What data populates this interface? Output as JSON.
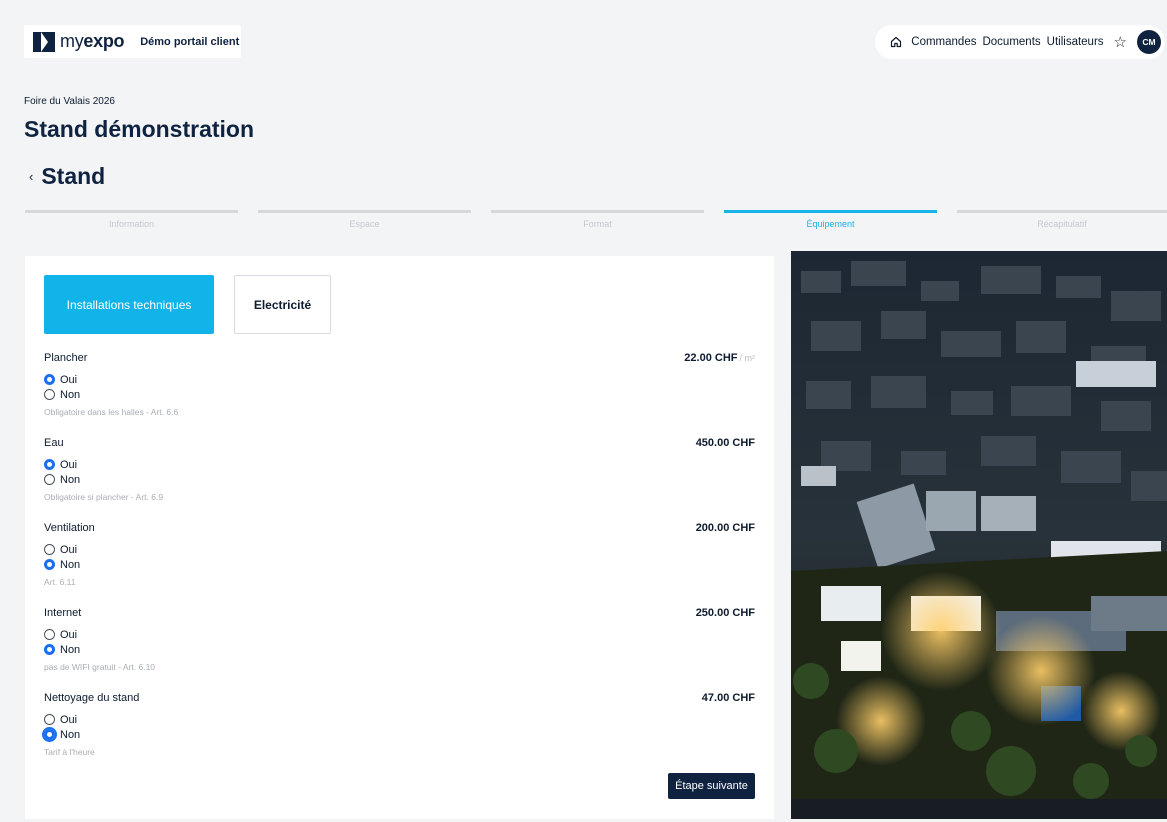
{
  "brand": {
    "logo_prefix": "my",
    "logo_bold": "expo",
    "portal_name": "Démo portail client"
  },
  "nav": {
    "items": [
      "Commandes",
      "Documents",
      "Utilisateurs"
    ],
    "avatar": "CM",
    "home_icon": "home-icon",
    "star_icon": "star-icon"
  },
  "page": {
    "event": "Foire du Valais 2026",
    "title": "Stand démonstration",
    "section": "Stand",
    "back_icon": "chevron-left-icon"
  },
  "steps": [
    {
      "label": "Information",
      "active": false
    },
    {
      "label": "Espace",
      "active": false
    },
    {
      "label": "Format",
      "active": false
    },
    {
      "label": "Équipement",
      "active": true
    },
    {
      "label": "Récapitulatif",
      "active": false
    }
  ],
  "tabs": {
    "active": "Installations techniques",
    "inactive": "Electricité"
  },
  "options": [
    {
      "name": "Plancher",
      "price": "22.00 CHF",
      "unit": "/ m²",
      "yes": "Oui",
      "no": "Non",
      "selected": "oui",
      "note": "Obligatoire dans les halles - Art. 6.6"
    },
    {
      "name": "Eau",
      "price": "450.00 CHF",
      "yes": "Oui",
      "no": "Non",
      "selected": "oui",
      "note": "Obligatoire si plancher - Art. 6.9"
    },
    {
      "name": "Ventilation",
      "price": "200.00 CHF",
      "yes": "Oui",
      "no": "Non",
      "selected": "non",
      "note": "Art. 6.11"
    },
    {
      "name": "Internet",
      "price": "250.00 CHF",
      "yes": "Oui",
      "no": "Non",
      "selected": "non",
      "note": "pas de WIFI gratuit - Art. 6.10"
    },
    {
      "name": "Nettoyage du stand",
      "price": "47.00 CHF",
      "yes": "Oui",
      "no": "Non",
      "selected": "non",
      "note": "Tarif à l'heure"
    }
  ],
  "next_label": "Étape suivante",
  "colors": {
    "navy": "#0f2340",
    "accent": "#11b4e8",
    "radio": "#1a6ef2"
  }
}
